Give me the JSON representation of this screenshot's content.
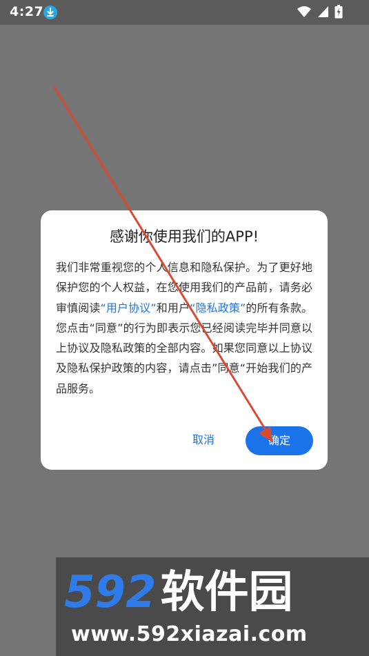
{
  "status_bar": {
    "time": "4:27",
    "icons": [
      "download-icon",
      "wifi-icon",
      "signal-icon",
      "battery-charging-icon"
    ]
  },
  "dialog": {
    "title": "感谢你使用我们的APP!",
    "body": {
      "text_1": "我们非常重视您的个人信息和隐私保护。为了更好地保护您的个人权益，在您使用我们的产品前，请务必审慎阅读",
      "link_user_agreement": "“用户协议”",
      "text_2": "和用户",
      "link_privacy_policy": "“隐私政策”",
      "text_3": "的所有条款。您点击“同意”的行为即表示您已经阅读完毕并同意以上协议及隐私政策的全部内容。如果您同意以上协议及隐私保护政策的内容，请点击”同意“开始我们的产品服务。"
    },
    "cancel_label": "取消",
    "confirm_label": "确定"
  },
  "watermark": {
    "logo_digits": "592",
    "logo_text": "软件园",
    "url": "www.592xiazai.com"
  },
  "colors": {
    "accent": "#1a73e8",
    "overlay": "#757575",
    "arrow": "#d94a32"
  }
}
